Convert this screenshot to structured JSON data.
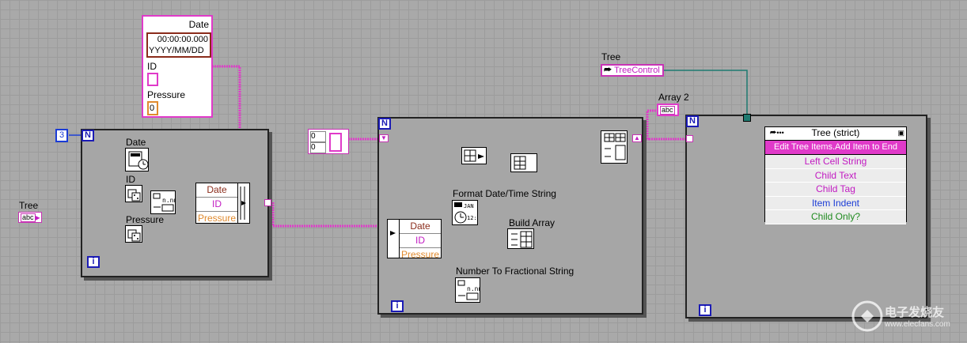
{
  "cluster": {
    "title": "Date",
    "time": "00:00:00.000",
    "date": "YYYY/MM/DD",
    "id_label": "ID",
    "pressure_label": "Pressure",
    "pressure_value": "0"
  },
  "loop1": {
    "count": "3",
    "n": "N",
    "i": "i",
    "date": "Date",
    "id": "ID",
    "pressure": "Pressure",
    "bundle": [
      "Date",
      "ID",
      "Pressure"
    ]
  },
  "tree_left": {
    "label": "Tree",
    "value": "abc"
  },
  "array_const": {
    "v1": "0",
    "v2": "0"
  },
  "loop2": {
    "n": "N",
    "i": "i",
    "unbundle": [
      "Date",
      "ID",
      "Pressure"
    ],
    "format_label": "Format Date/Time String",
    "build_label": "Build Array",
    "number_label": "Number To Fractional String"
  },
  "tree_ref": {
    "label": "Tree",
    "value": "TreeControl"
  },
  "array2": {
    "label": "Array 2",
    "value": "abc"
  },
  "loop3": {
    "n": "N",
    "i": "i"
  },
  "tree_node": {
    "title": "Tree (strict)",
    "method": "Edit Tree Items.Add Item to End",
    "items": [
      "Left Cell String",
      "Child Text",
      "Child Tag",
      "Item Indent",
      "Child Only?"
    ]
  },
  "watermark": {
    "cn": "电子发烧友",
    "url": "www.elecfans.com"
  },
  "colors": {
    "string_wire": "#e03ac9",
    "cluster_wire": "#b23b24",
    "blue_wire": "#1b3cd6",
    "ref_wire": "#1e7a70",
    "orange": "#e08a2e"
  }
}
